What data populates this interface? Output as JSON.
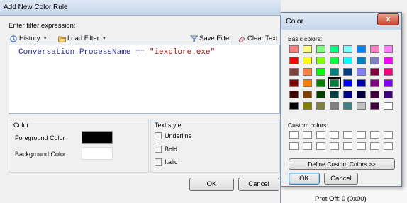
{
  "main_dialog": {
    "title": "Add New Color Rule",
    "filter_label": "Enter filter expression:",
    "toolbar": {
      "history": "History",
      "load_filter": "Load Filter",
      "save_filter": "Save Filter",
      "clear_text": "Clear Text"
    },
    "expression": {
      "left": "Conversation.ProcessName == ",
      "right": "\"iexplore.exe\""
    },
    "color_group": {
      "title": "Color",
      "foreground_label": "Foreground Color",
      "foreground_color": "#000000",
      "background_label": "Background Color",
      "background_color": "#ffffff"
    },
    "text_style_group": {
      "title": "Text style",
      "underline": "Underline",
      "bold": "Bold",
      "italic": "Italic"
    },
    "ok_label": "OK",
    "cancel_label": "Cancel"
  },
  "color_dialog": {
    "title": "Color",
    "close_label": "x",
    "basic_label": "Basic colors:",
    "custom_label": "Custom colors:",
    "define_custom_label": "Define Custom Colors >>",
    "ok_label": "OK",
    "cancel_label": "Cancel",
    "selected_index": 27,
    "basic_colors": [
      "#ff8080",
      "#ffff80",
      "#80ff80",
      "#00ff80",
      "#80ffff",
      "#0080ff",
      "#ff80c0",
      "#ff80ff",
      "#ff0000",
      "#ffff00",
      "#80ff00",
      "#00ff40",
      "#00ffff",
      "#0080c0",
      "#8080c0",
      "#ff00ff",
      "#804040",
      "#ff8040",
      "#00ff00",
      "#008080",
      "#004080",
      "#8080ff",
      "#800040",
      "#ff0080",
      "#800000",
      "#ff8000",
      "#008000",
      "#008040",
      "#0000ff",
      "#0000a0",
      "#800080",
      "#8000ff",
      "#400000",
      "#804000",
      "#004000",
      "#004040",
      "#000080",
      "#000040",
      "#400040",
      "#400080",
      "#000000",
      "#808000",
      "#808040",
      "#808080",
      "#408080",
      "#c0c0c0",
      "#400040",
      "#ffffff"
    ]
  },
  "background_app": {
    "text": "Prot Off: 0 (0x00)"
  }
}
